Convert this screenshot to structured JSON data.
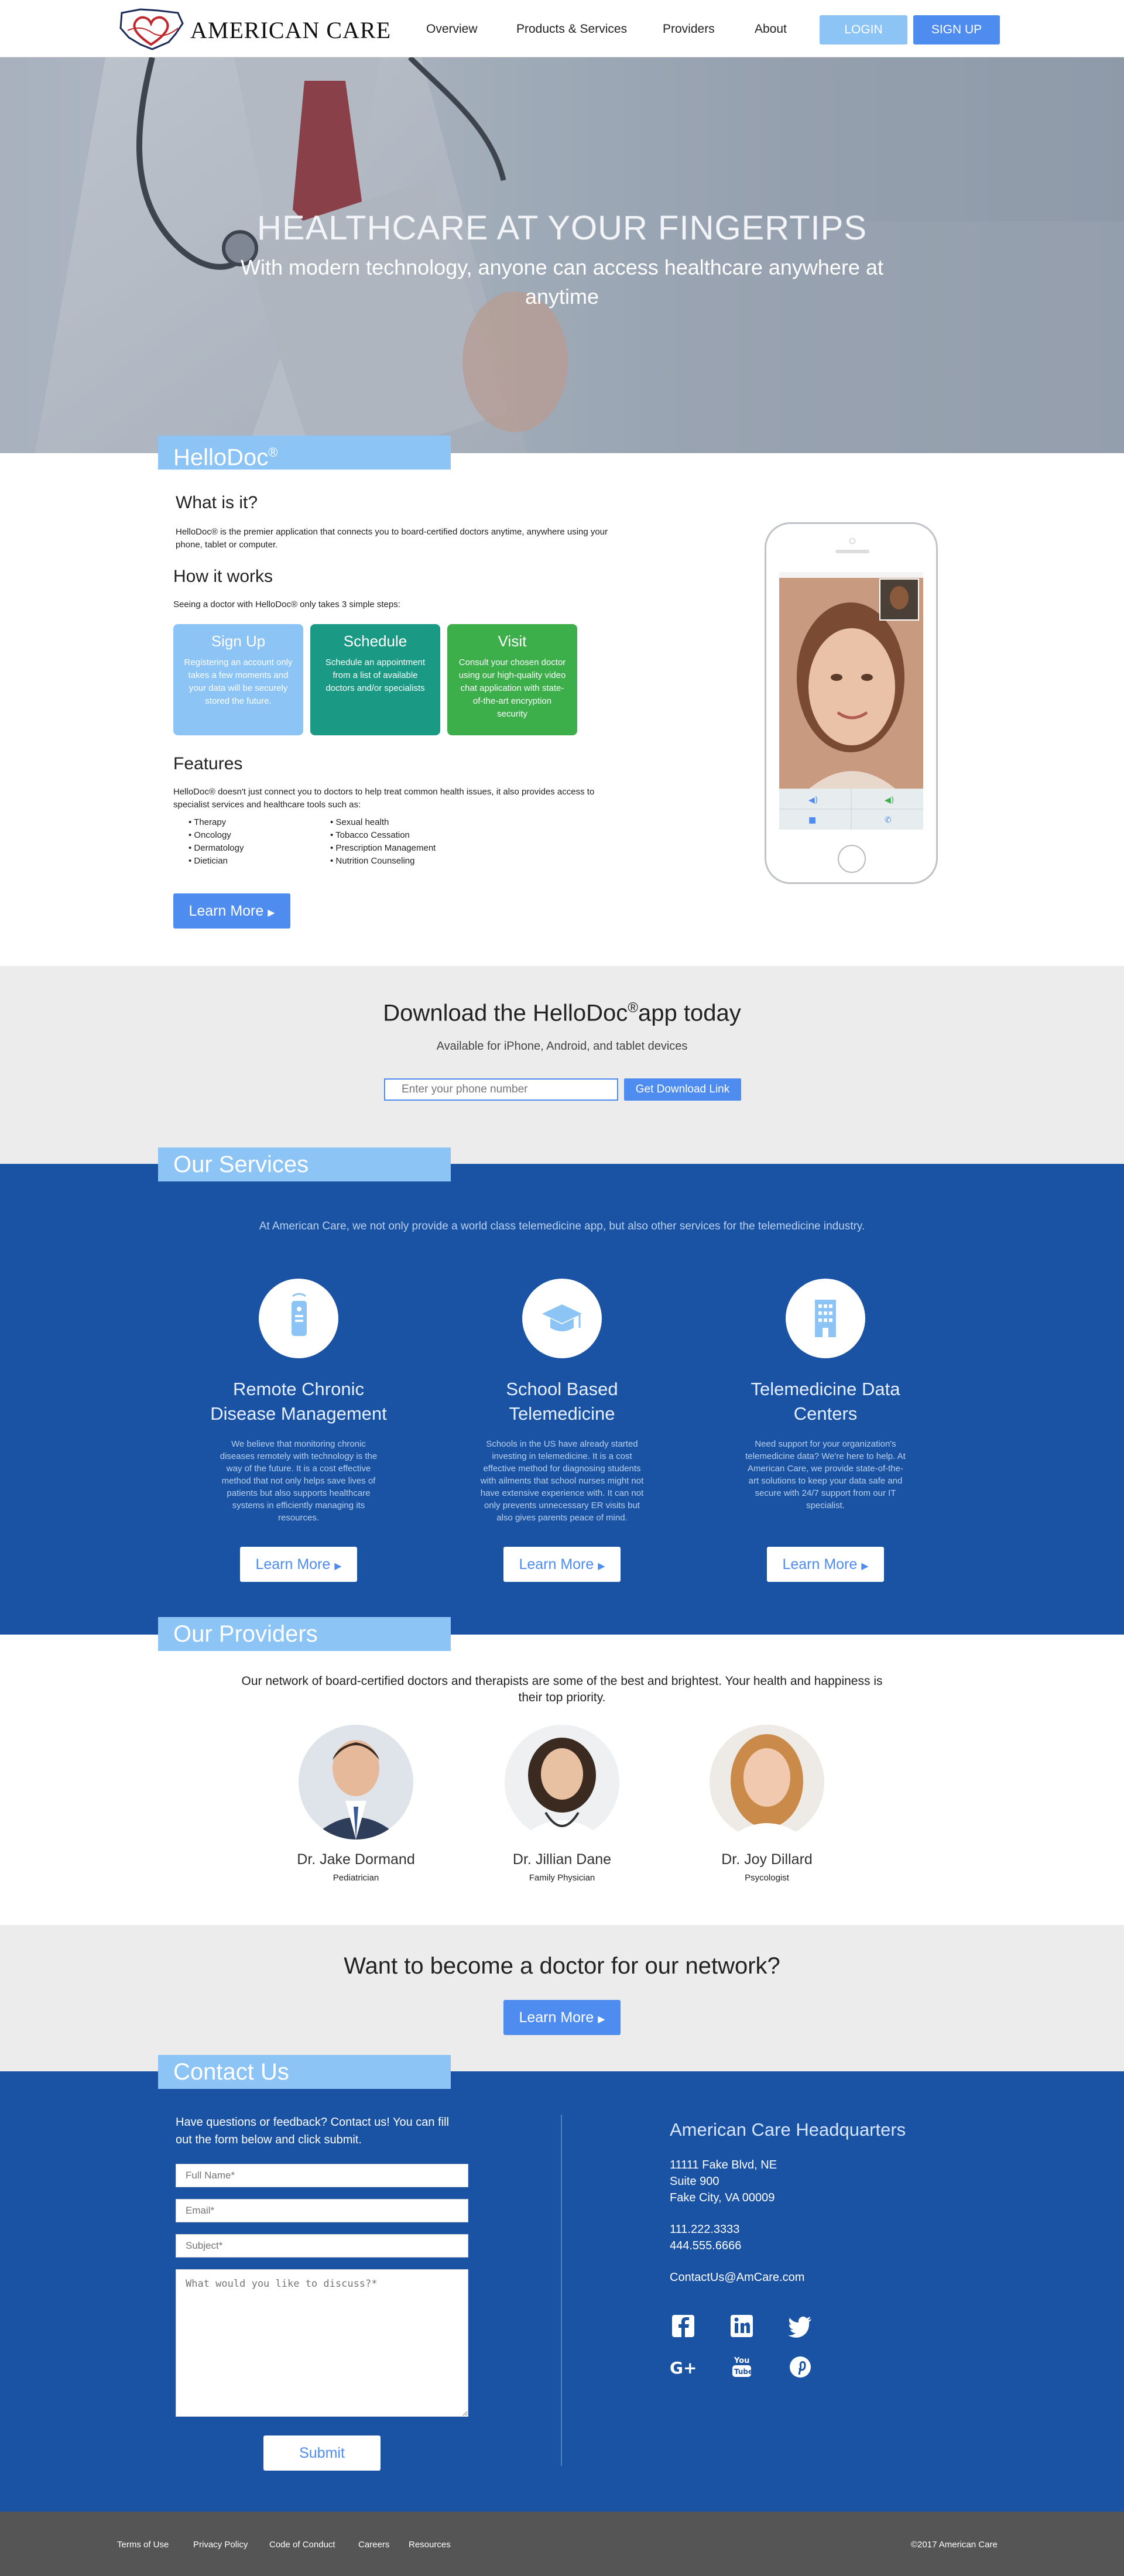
{
  "header": {
    "brand": "AMERICAN CARE",
    "nav": [
      "Overview",
      "Products & Services",
      "Providers",
      "About"
    ],
    "login_label": "LOGIN",
    "signup_label": "SIGN UP"
  },
  "hero": {
    "title": "HEALTHCARE AT YOUR FINGERTIPS",
    "subtitle": "With modern technology, anyone can access healthcare anywhere at anytime"
  },
  "hellodoc": {
    "tab_label": "HelloDoc",
    "tab_mark": "®",
    "what_heading": "What is it?",
    "what_text": "HelloDoc® is the premier application that connects you to board-certified doctors anytime, anywhere using your phone, tablet or computer.",
    "how_heading": "How it works",
    "how_text": "Seeing a doctor with HelloDoc® only takes 3 simple steps:",
    "steps": [
      {
        "title": "Sign Up",
        "text": "Registering an account only takes a few moments and your data will be securely stored the future."
      },
      {
        "title": "Schedule",
        "text": "Schedule an appointment from a list of available doctors and/or specialists"
      },
      {
        "title": "Visit",
        "text": "Consult your chosen doctor using our high-quality video chat application with state-of-the-art encryption security"
      }
    ],
    "features_heading": "Features",
    "features_text": "HelloDoc® doesn't just connect you to doctors to help treat common health issues, it also provides access to specialist services and healthcare tools such as:",
    "features_col1": [
      "Therapy",
      "Oncology",
      "Dermatology",
      "Dietician"
    ],
    "features_col2": [
      "Sexual health",
      "Tobacco Cessation",
      "Prescription Management",
      "Nutrition Counseling"
    ],
    "learn_more_label": "Learn More"
  },
  "download": {
    "title": "Download the HelloDoc",
    "title_mark": "®",
    "title_suffix": "app today",
    "subtitle": "Available for iPhone, Android, and tablet devices",
    "phone_placeholder": "Enter your phone number",
    "button_label": "Get Download Link"
  },
  "services": {
    "tab_label": "Our Services",
    "intro": "At American Care, we not only provide a world class telemedicine app, but also other services for the telemedicine industry.",
    "items": [
      {
        "title": "Remote Chronic Disease Management",
        "icon": "remote-device-icon",
        "text": "We believe that monitoring chronic diseases remotely with technology is the way of the future. It is a cost effective method that not only helps save lives of patients but also supports healthcare systems in efficiently managing its resources.",
        "button": "Learn More"
      },
      {
        "title": "School Based Telemedicine",
        "icon": "graduation-cap-icon",
        "text": "Schools in the US have already started investing in telemedicine. It is a cost effective method for diagnosing students with ailments that school nurses might not have extensive experience with. It can not only prevents unnecessary ER visits but also gives parents peace of mind.",
        "button": "Learn More"
      },
      {
        "title": "Telemedicine Data Centers",
        "icon": "building-icon",
        "text": "Need support for your organization's telemedicine data? We're here to help. At American Care, we provide state-of-the-art solutions to keep your data safe and secure with 24/7 support from our IT specialist.",
        "button": "Learn More"
      }
    ]
  },
  "providers": {
    "tab_label": "Our Providers",
    "intro": "Our network of board-certified doctors and therapists are some of the best and brightest. Your health and happiness is their top priority.",
    "items": [
      {
        "name": "Dr. Jake Dormand",
        "role": "Pediatrician"
      },
      {
        "name": "Dr. Jillian Dane",
        "role": "Family Physician"
      },
      {
        "name": "Dr. Joy Dillard",
        "role": "Psycologist"
      }
    ]
  },
  "cta": {
    "title": "Want to become a doctor for our network?",
    "button_label": "Learn More"
  },
  "contact": {
    "tab_label": "Contact Us",
    "intro": "Have questions or feedback? Contact us! You can fill out the form below and click submit.",
    "full_name_placeholder": "Full Name*",
    "email_placeholder": "Email*",
    "subject_placeholder": "Subject*",
    "message_placeholder": "What would you like to discuss?*",
    "submit_label": "Submit",
    "hq_title": "American Care Headquarters",
    "address": [
      "11111 Fake Blvd, NE",
      "Suite 900",
      "Fake City, VA 00009"
    ],
    "phones": [
      "111.222.3333",
      "444.555.6666"
    ],
    "email": "ContactUs@AmCare.com",
    "social": [
      "facebook-icon",
      "linkedin-icon",
      "twitter-icon",
      "google-plus-icon",
      "youtube-icon",
      "pinterest-icon"
    ]
  },
  "footer": {
    "links": [
      "Terms of Use",
      "Privacy Policy",
      "Code of Conduct",
      "Careers",
      "Resources"
    ],
    "copyright": "©2017 American Care"
  },
  "colors": {
    "accent": "#4e8cf0",
    "light_accent": "#8cc4f5",
    "dark_blue": "#1a52a4",
    "step_signup": "#8cc4f5",
    "step_schedule": "#1a9a84",
    "step_visit": "#3cae4a",
    "footer": "#555555"
  }
}
